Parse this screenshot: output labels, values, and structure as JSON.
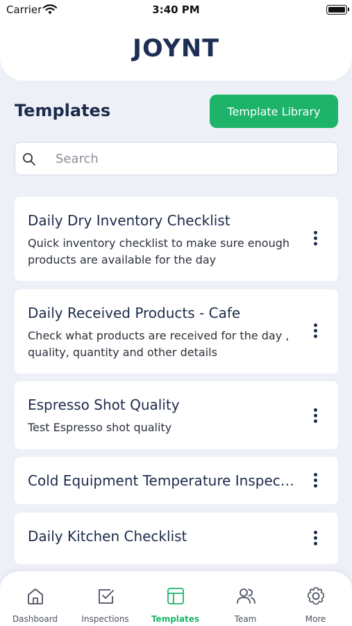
{
  "status_bar": {
    "carrier": "Carrier",
    "time": "3:40 PM"
  },
  "header": {
    "logo": "JOYNT"
  },
  "page": {
    "title": "Templates",
    "library_button": "Template Library"
  },
  "search": {
    "placeholder": "Search"
  },
  "templates": [
    {
      "title": "Daily Dry Inventory Checklist",
      "description": "Quick inventory checklist to make sure enough products are available for the day"
    },
    {
      "title": "Daily Received Products - Cafe",
      "description": "Check what products are received for the day , quality, quantity and other details"
    },
    {
      "title": "Espresso Shot Quality",
      "description": "Test Espresso shot quality"
    },
    {
      "title": "Cold Equipment Temperature Inspection",
      "description": ""
    },
    {
      "title": "Daily Kitchen Checklist",
      "description": ""
    }
  ],
  "nav": {
    "items": [
      {
        "label": "Dashboard",
        "icon": "home-icon"
      },
      {
        "label": "Inspections",
        "icon": "checkbox-icon"
      },
      {
        "label": "Templates",
        "icon": "layout-icon",
        "active": true
      },
      {
        "label": "Team",
        "icon": "users-icon"
      },
      {
        "label": "More",
        "icon": "gear-icon"
      }
    ]
  },
  "colors": {
    "accent": "#1db46a",
    "text": "#1c2a4a",
    "background": "#eef0f8"
  }
}
